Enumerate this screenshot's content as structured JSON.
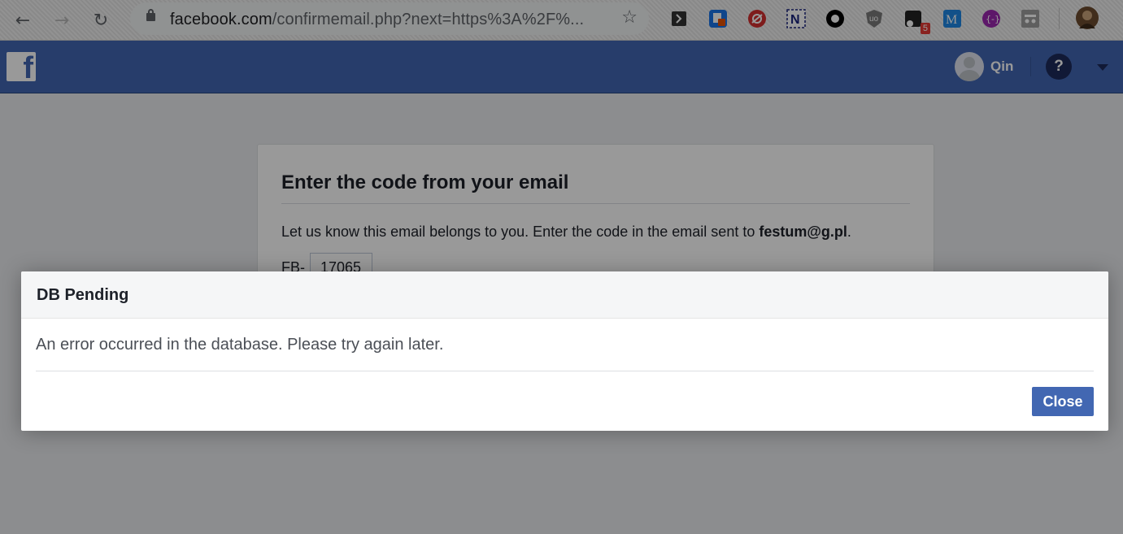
{
  "browser": {
    "url_host": "facebook.com",
    "url_path": "/confirmemail.php?next=https%3A%2F%...",
    "extensions": [
      {
        "name": "extension-bookmark-icon",
        "color": "#333333"
      },
      {
        "name": "extension-lock-icon",
        "color": "#1a73e8"
      },
      {
        "name": "extension-lastpass-icon",
        "color": "#d32f2f"
      },
      {
        "name": "extension-n-icon",
        "color": "#1a237e"
      },
      {
        "name": "extension-circle-icon",
        "color": "#000000"
      },
      {
        "name": "extension-ublock-icon",
        "color": "#7a7a7a"
      },
      {
        "name": "extension-badge-icon",
        "color": "#222222",
        "badge": "5"
      },
      {
        "name": "extension-m-icon",
        "color": "#1e88e5"
      },
      {
        "name": "extension-purple-icon",
        "color": "#9c27b0"
      },
      {
        "name": "extension-incognito-icon",
        "color": "#9e9e9e"
      }
    ]
  },
  "fb_header": {
    "logo": "f",
    "user_name": "Qin",
    "help_label": "?"
  },
  "card": {
    "title": "Enter the code from your email",
    "text_prefix": "Let us know this email belongs to you. Enter the code in the email sent to ",
    "email": "festum@g.pl",
    "text_suffix": ".",
    "code_prefix": "FB-",
    "code_value": "17065"
  },
  "dialog": {
    "title": "DB Pending",
    "message": "An error occurred in the database. Please try again later.",
    "close_label": "Close"
  },
  "colors": {
    "fb_blue": "#4267b2",
    "error_badge": "#e53935"
  }
}
